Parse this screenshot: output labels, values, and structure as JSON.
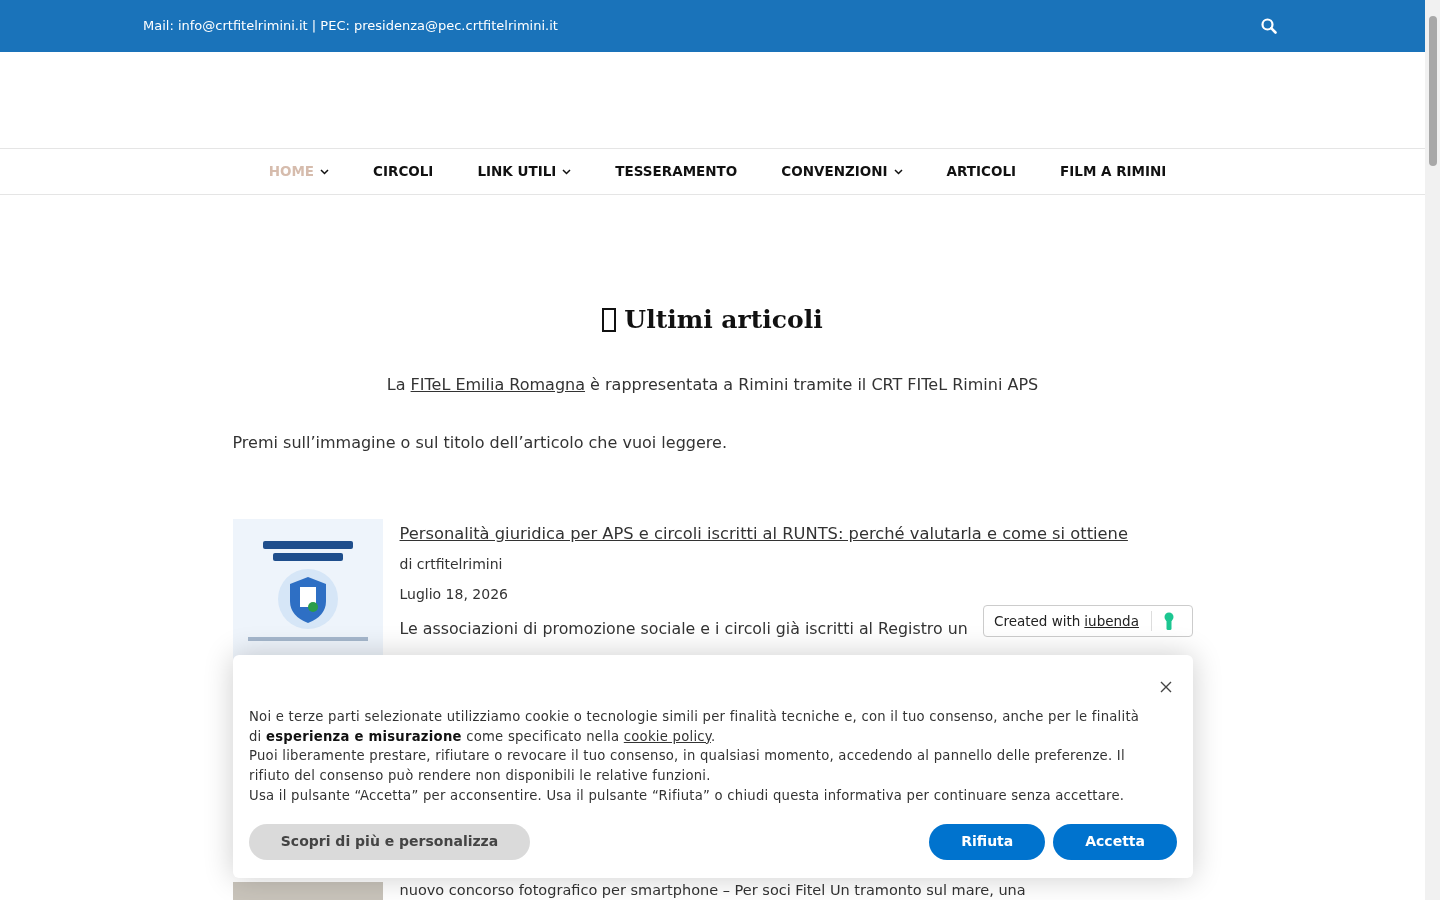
{
  "top_bar": {
    "contact": "Mail: info@crtfitelrimini.it | PEC: presidenza@pec.crtfitelrimini.it"
  },
  "nav": [
    {
      "label": "HOME",
      "selected": true,
      "has_submenu": true
    },
    {
      "label": "CIRCOLI",
      "selected": false,
      "has_submenu": false
    },
    {
      "label": "LINK UTILI",
      "selected": false,
      "has_submenu": true
    },
    {
      "label": "TESSERAMENTO",
      "selected": false,
      "has_submenu": false
    },
    {
      "label": "CONVENZIONI",
      "selected": false,
      "has_submenu": true
    },
    {
      "label": "ARTICOLI",
      "selected": false,
      "has_submenu": false
    },
    {
      "label": "FILM A RIMINI",
      "selected": false,
      "has_submenu": false
    }
  ],
  "heading": "Ultimi articoli",
  "intro": {
    "before": "La",
    "link": "FITeL Emilia Romagna",
    "after": "è rappresentata a Rimini tramite il CRT FITeL Rimini APS"
  },
  "hint": "Premi sull’immagine o sul titolo dell’articolo che vuoi leggere.",
  "articles": [
    {
      "title": "Personalità giuridica per APS e circoli iscritti al RUNTS: perché valutarla e come si ottiene",
      "author": "di crtfitelrimini",
      "date": "Luglio 18, 2026",
      "excerpt": "Le associazioni di promozione sociale e i circoli già iscritti al Registro un"
    },
    {
      "excerpt": "nuovo concorso fotografico per smartphone – Per soci Fitel Un tramonto sul mare, una"
    }
  ],
  "iubenda_badge": {
    "text": "Created with",
    "link": "iubenda"
  },
  "cookie_banner": {
    "paragraphs": [
      {
        "text": "Noi e terze parti selezionate utilizziamo cookie o tecnologie simili per finalità tecniche e, con il tuo consenso, anche per le finalità di **esperienza e misurazione** come specificato nella",
        "link": "cookie policy",
        "after": "."
      },
      {
        "text": "Puoi liberamente prestare, rifiutare o revocare il tuo consenso, in qualsiasi momento, accedendo al pannello delle preferenze. Il rifiuto del consenso può rendere non disponibili le relative funzioni."
      },
      {
        "text": "Usa il pulsante “Accetta” per acconsentire. Usa il pulsante “Rifiuta” o chiudi questa informativa per continuare senza accettare."
      }
    ],
    "buttons": [
      {
        "label": "Scopri di più e personalizza",
        "kind": "secondary"
      },
      {
        "label": "Rifiuta",
        "kind": "primary"
      },
      {
        "label": "Accetta",
        "kind": "primary"
      }
    ]
  }
}
